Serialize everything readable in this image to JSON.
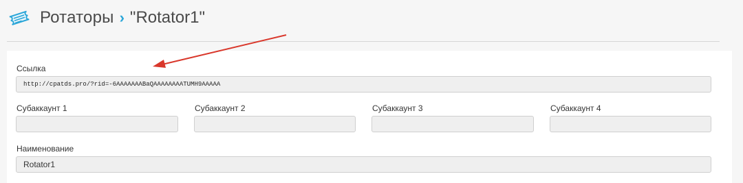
{
  "breadcrumb": {
    "section": "Ротаторы",
    "separator": "›",
    "current": "\"Rotator1\""
  },
  "form": {
    "link_label": "Ссылка",
    "link_value": "http://cpatds.pro/?rid=-6AAAAAAABaQAAAAAAAATUMH9AAAAA",
    "subaccounts": [
      {
        "label": "Субаккаунт 1",
        "value": ""
      },
      {
        "label": "Субаккаунт 2",
        "value": ""
      },
      {
        "label": "Субаккаунт 3",
        "value": ""
      },
      {
        "label": "Субаккаунт 4",
        "value": ""
      }
    ],
    "name_label": "Наименование",
    "name_value": "Rotator1"
  },
  "icons": {
    "header_icon": "ticket-icon",
    "annotation": "red-arrow"
  },
  "colors": {
    "accent": "#2ba6d8",
    "arrow": "#d9372b"
  }
}
